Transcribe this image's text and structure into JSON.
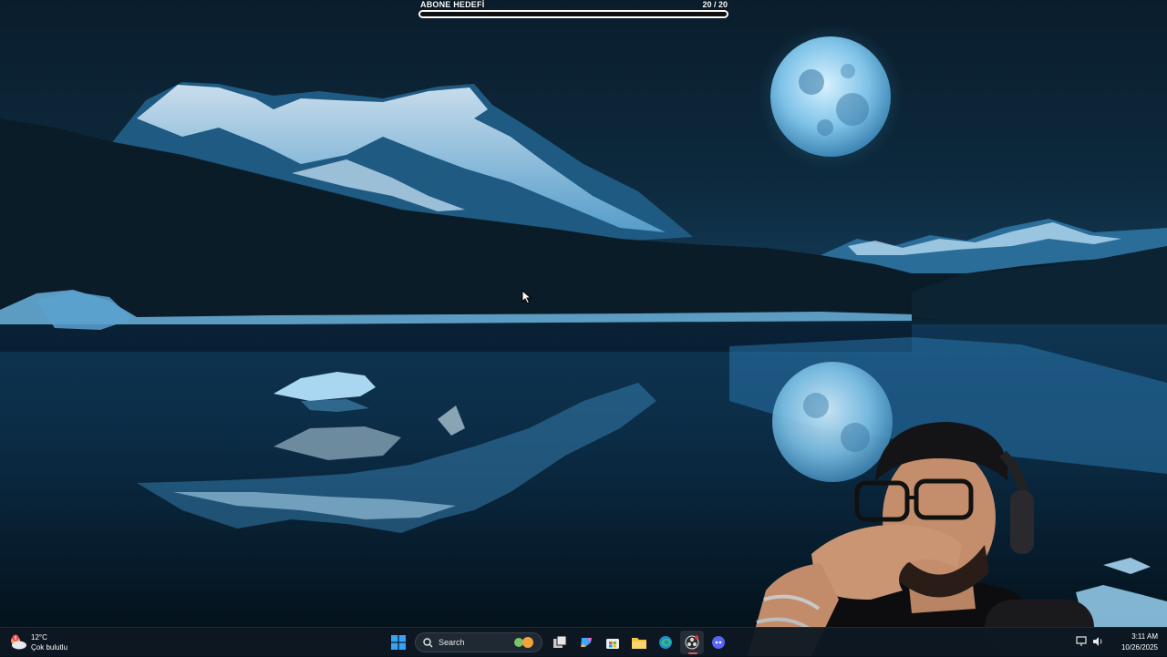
{
  "overlay": {
    "goal_title": "ABONE HEDEFİ",
    "goal_count": "20  / 20",
    "goal_progress": 1.0
  },
  "taskbar": {
    "weather": {
      "temp": "12°C",
      "condition": "Çok bulutlu",
      "badge": "8",
      "icon": "partly-cloudy-icon"
    },
    "search_placeholder": "Search",
    "apps": [
      {
        "name": "start-button",
        "icon": "windows-logo-icon"
      },
      {
        "name": "search-box",
        "icon": "search-icon"
      },
      {
        "name": "task-view-button",
        "icon": "task-view-icon"
      },
      {
        "name": "copilot-button",
        "icon": "copilot-icon"
      },
      {
        "name": "store-button",
        "icon": "store-icon"
      },
      {
        "name": "file-explorer-button",
        "icon": "folder-icon"
      },
      {
        "name": "edge-button",
        "icon": "edge-icon"
      },
      {
        "name": "obs-button",
        "icon": "obs-icon"
      },
      {
        "name": "discord-button",
        "icon": "discord-icon"
      }
    ],
    "clock": {
      "time": "3:11 AM",
      "date": "10/26/2025"
    },
    "tray_icons": [
      "display-icon",
      "volume-icon"
    ]
  },
  "colors": {
    "taskbar_bg": "#0e1822",
    "goal_border": "#ffffff",
    "moon": "#9fd6f2"
  }
}
